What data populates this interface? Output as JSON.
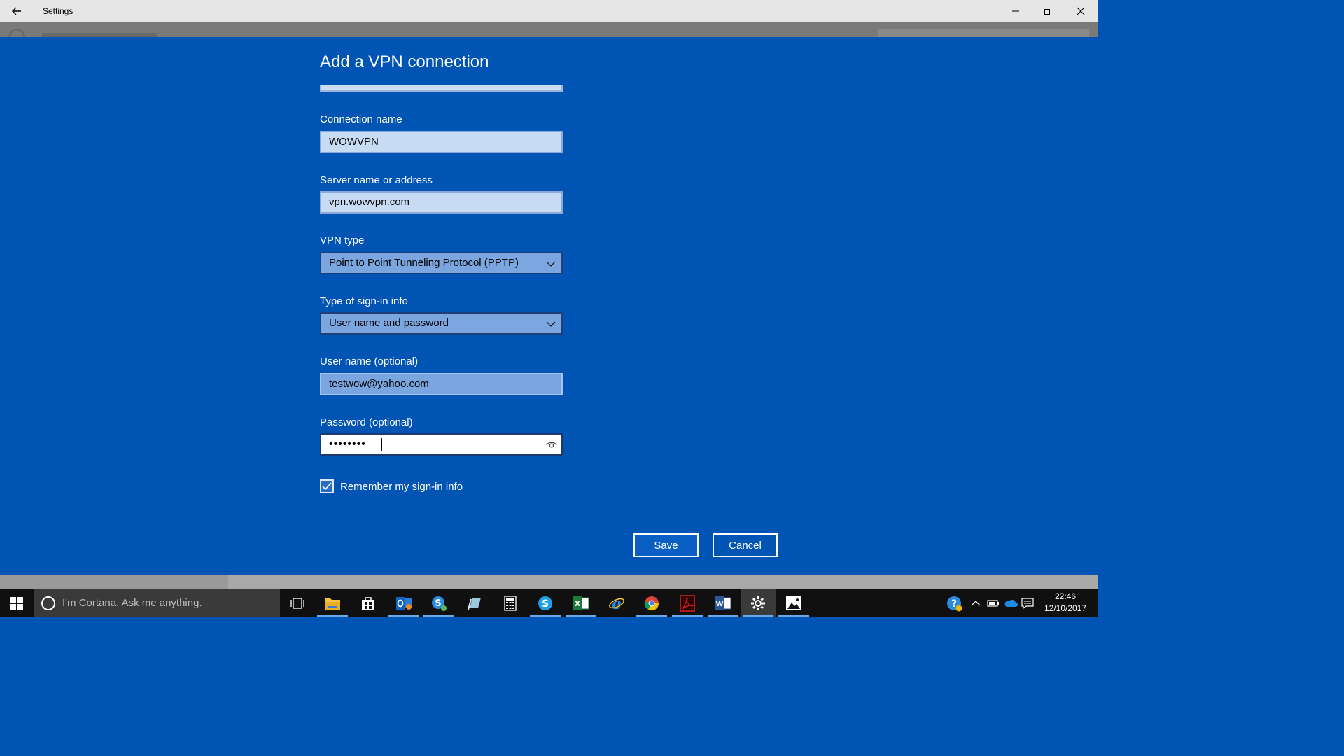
{
  "window": {
    "title": "Settings",
    "icons": {
      "back": "back-arrow-icon",
      "minimize": "minimize-icon",
      "maximize": "restore-icon",
      "close": "close-icon"
    }
  },
  "dialog": {
    "title": "Add a VPN connection",
    "fields": {
      "connection_name": {
        "label": "Connection name",
        "value": "WOWVPN"
      },
      "server": {
        "label": "Server name or address",
        "value": "vpn.wowvpn.com"
      },
      "vpn_type": {
        "label": "VPN type",
        "value": "Point to Point Tunneling Protocol (PPTP)"
      },
      "signin_type": {
        "label": "Type of sign-in info",
        "value": "User name and password"
      },
      "username": {
        "label": "User name (optional)",
        "value": "testwow@yahoo.com"
      },
      "password": {
        "label": "Password (optional)",
        "value": "••••••••"
      }
    },
    "remember": {
      "label": "Remember my sign-in info",
      "checked": true
    },
    "buttons": {
      "save": "Save",
      "cancel": "Cancel"
    }
  },
  "taskbar": {
    "search_placeholder": "I'm Cortana. Ask me anything.",
    "apps": [
      "task-view",
      "file-explorer",
      "store",
      "outlook",
      "skype-business",
      "notes",
      "calculator",
      "skype",
      "excel",
      "edge",
      "chrome",
      "acrobat",
      "word",
      "settings",
      "photos"
    ],
    "clock": {
      "time": "22:46",
      "date": "12/10/2017"
    },
    "colors": {
      "accent": "#0054b4",
      "taskbar": "#101010"
    }
  }
}
